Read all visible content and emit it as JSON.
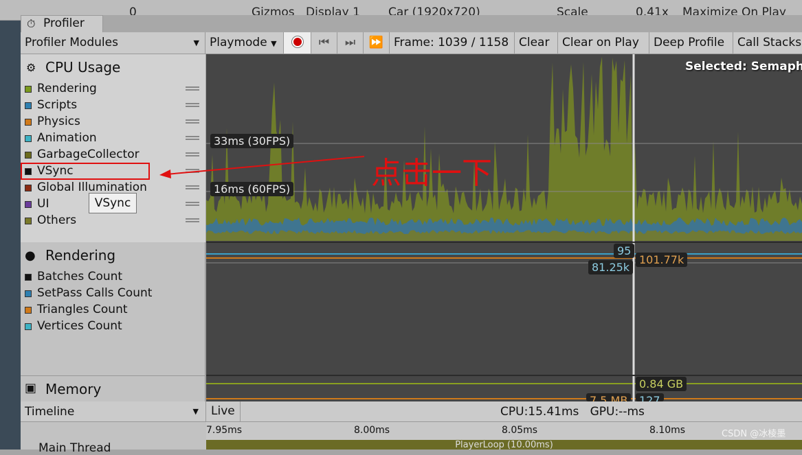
{
  "unity_toolbar": {
    "gizmos": "Gizmos",
    "count": "0",
    "display": "Display 1",
    "resolution": "Car (1920x720)",
    "scale_label": "Scale",
    "scale_value": "0.41x",
    "maximize": "Maximize On Play"
  },
  "window": {
    "tab": "Profiler"
  },
  "toolbar": {
    "modules": "Profiler Modules",
    "playmode": "Playmode",
    "frame": "Frame: 1039 / 1158",
    "clear": "Clear",
    "clear_on_play": "Clear on Play",
    "deep_profile": "Deep Profile",
    "call_stacks": "Call Stacks"
  },
  "cpu": {
    "title": "CPU Usage",
    "items": [
      {
        "label": "Rendering",
        "color": "#7a9a1d"
      },
      {
        "label": "Scripts",
        "color": "#2e7fb0"
      },
      {
        "label": "Physics",
        "color": "#d07a1a"
      },
      {
        "label": "Animation",
        "color": "#3cb2c4"
      },
      {
        "label": "GarbageCollector",
        "color": "#6b6b1d"
      },
      {
        "label": "VSync",
        "color": "#111111"
      },
      {
        "label": "Global Illumination",
        "color": "#8c2a12"
      },
      {
        "label": "UI",
        "color": "#6a3c9a"
      },
      {
        "label": "Others",
        "color": "#7a7a2a"
      }
    ],
    "selected": "Selected: Semaphore",
    "line33": "33ms (30FPS)",
    "line16": "16ms (60FPS)"
  },
  "tooltip": "VSync",
  "rendering": {
    "title": "Rendering",
    "items": [
      {
        "label": "Batches Count",
        "color": "#111111"
      },
      {
        "label": "SetPass Calls Count",
        "color": "#2e7fb0"
      },
      {
        "label": "Triangles Count",
        "color": "#d07a1a"
      },
      {
        "label": "Vertices Count",
        "color": "#3cb2c4"
      }
    ],
    "val_setpass": "95",
    "val_batches": "81.25k",
    "val_tris": "101.77k"
  },
  "memory": {
    "title": "Memory",
    "val_total": "0.84 GB",
    "val_b": "7.5 MB",
    "val_c": "127"
  },
  "bottom": {
    "view": "Timeline",
    "live": "Live",
    "stats": "CPU:15.41ms   GPU:--ms",
    "ticks": [
      "7.95ms",
      "8.00ms",
      "8.05ms",
      "8.10ms"
    ],
    "thread": "Main Thread",
    "playerloop": "PlayerLoop (10.00ms)"
  },
  "annotation": {
    "text": "点击一下",
    "color": "#e01010"
  },
  "watermark": "CSDN @冰棱墨"
}
